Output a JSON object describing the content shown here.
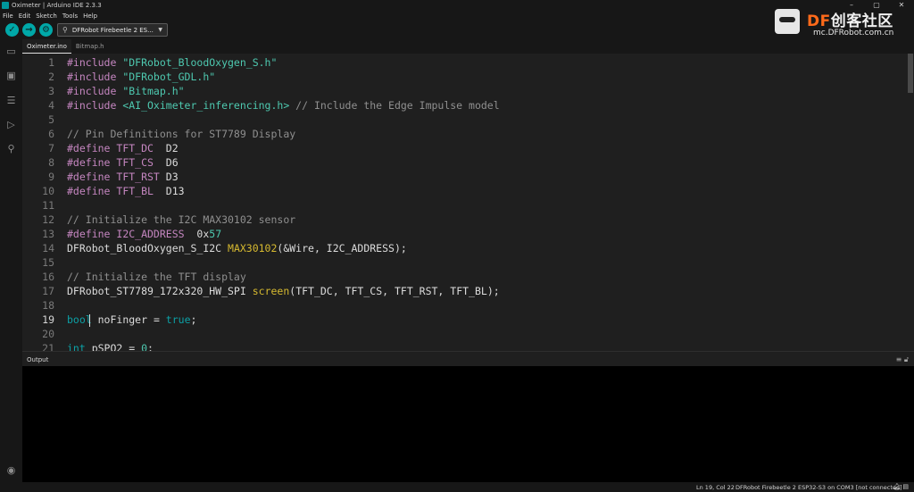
{
  "window": {
    "title": "Oximeter | Arduino IDE 2.3.3",
    "controls": [
      "–",
      "▢",
      "✕"
    ]
  },
  "menu": [
    "File",
    "Edit",
    "Sketch",
    "Tools",
    "Help"
  ],
  "toolbar": {
    "verify_icon": "check-icon",
    "upload_icon": "arrow-right-icon",
    "debug_icon": "debug-icon",
    "board_label": "DFRobot Firebeetle 2 ES...",
    "usb_icon": "usb-icon"
  },
  "logo": {
    "brand_df": "DF",
    "brand_rest": "创客社区",
    "url": "mc.DFRobot.com.cn"
  },
  "activity": [
    "folder-icon",
    "board-icon",
    "library-icon",
    "debug-icon",
    "search-icon",
    "account-icon"
  ],
  "tabs": [
    {
      "label": "Oximeter.ino",
      "active": true
    },
    {
      "label": "Bitmap.h",
      "active": false
    }
  ],
  "editor": {
    "current_line": 19,
    "lines": [
      {
        "n": "1",
        "tokens": [
          [
            "pp",
            "#include "
          ],
          [
            "str",
            "\"DFRobot_BloodOxygen_S.h\""
          ]
        ]
      },
      {
        "n": "2",
        "tokens": [
          [
            "pp",
            "#include "
          ],
          [
            "str",
            "\"DFRobot_GDL.h\""
          ]
        ]
      },
      {
        "n": "3",
        "tokens": [
          [
            "pp",
            "#include "
          ],
          [
            "str",
            "\"Bitmap.h\""
          ]
        ]
      },
      {
        "n": "4",
        "tokens": [
          [
            "pp",
            "#include "
          ],
          [
            "str",
            "<AI_Oximeter_inferencing.h>"
          ],
          [
            "cm",
            " // Include the Edge Impulse model"
          ]
        ]
      },
      {
        "n": "5",
        "tokens": []
      },
      {
        "n": "6",
        "tokens": [
          [
            "cm",
            "// Pin Definitions for ST7789 Display"
          ]
        ]
      },
      {
        "n": "7",
        "tokens": [
          [
            "pp",
            "#define "
          ],
          [
            "mac",
            "TFT_DC"
          ],
          [
            "id",
            "  D2"
          ]
        ]
      },
      {
        "n": "8",
        "tokens": [
          [
            "pp",
            "#define "
          ],
          [
            "mac",
            "TFT_CS"
          ],
          [
            "id",
            "  D6"
          ]
        ]
      },
      {
        "n": "9",
        "tokens": [
          [
            "pp",
            "#define "
          ],
          [
            "mac",
            "TFT_RST"
          ],
          [
            "id",
            " D3"
          ]
        ]
      },
      {
        "n": "10",
        "tokens": [
          [
            "pp",
            "#define "
          ],
          [
            "mac",
            "TFT_BL"
          ],
          [
            "id",
            "  D13"
          ]
        ]
      },
      {
        "n": "11",
        "tokens": []
      },
      {
        "n": "12",
        "tokens": [
          [
            "cm",
            "// Initialize the I2C MAX30102 sensor"
          ]
        ]
      },
      {
        "n": "13",
        "tokens": [
          [
            "pp",
            "#define "
          ],
          [
            "mac",
            "I2C_ADDRESS"
          ],
          [
            "id",
            "  0x"
          ],
          [
            "num",
            "57"
          ]
        ]
      },
      {
        "n": "14",
        "tokens": [
          [
            "id",
            "DFRobot_BloodOxygen_S_I2C "
          ],
          [
            "fn",
            "MAX30102"
          ],
          [
            "id",
            "(&Wire, I2C_ADDRESS);"
          ]
        ]
      },
      {
        "n": "15",
        "tokens": []
      },
      {
        "n": "16",
        "tokens": [
          [
            "cm",
            "// Initialize the TFT display"
          ]
        ]
      },
      {
        "n": "17",
        "tokens": [
          [
            "id",
            "DFRobot_ST7789_172x320_HW_SPI "
          ],
          [
            "fn",
            "screen"
          ],
          [
            "id",
            "(TFT_DC, TFT_CS, TFT_RST, TFT_BL);"
          ]
        ]
      },
      {
        "n": "18",
        "tokens": []
      },
      {
        "n": "19",
        "tokens": [
          [
            "kw",
            "bool"
          ],
          [
            "id",
            " noFinger = "
          ],
          [
            "val",
            "true"
          ],
          [
            "id",
            ";"
          ]
        ]
      },
      {
        "n": "20",
        "tokens": []
      },
      {
        "n": "21",
        "tokens": [
          [
            "kw",
            "int"
          ],
          [
            "id",
            " pSPO2 = "
          ],
          [
            "num",
            "0"
          ],
          [
            "id",
            ";"
          ]
        ]
      }
    ]
  },
  "output": {
    "title": "Output",
    "icons": [
      "list-icon",
      "lock-icon"
    ]
  },
  "status": {
    "position": "Ln 19, Col 22",
    "board": "DFRobot Firebeetle 2 ESP32-S3 on COM3 [not connected]",
    "icons": [
      "notification-icon",
      "panel-icon"
    ]
  }
}
